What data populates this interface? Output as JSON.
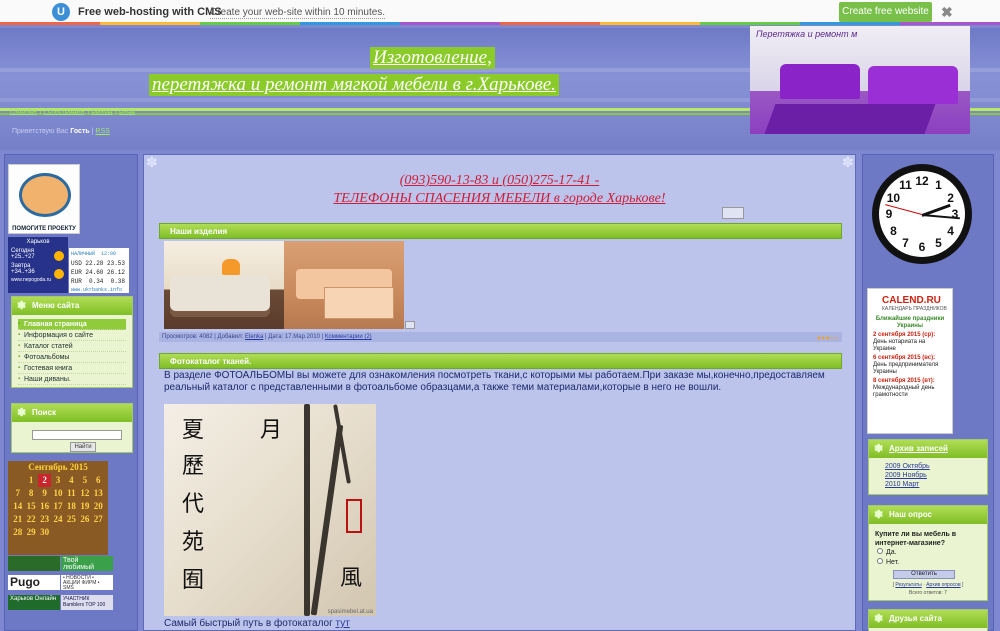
{
  "promo": {
    "logo_letter": "U",
    "title": "Free web-hosting with CMS",
    "subtitle": "Create your web-site within 10 minutes.",
    "cta": "Create free website",
    "close": "✖"
  },
  "header": {
    "title_line1": "Изготовление,",
    "title_line2": "перетяжка и ремонт мягкой мебели в г.Харькове.",
    "photo_caption": "Перетяжка и ремонт м",
    "nav": [
      "Главная",
      "Регистрация",
      "Выход",
      "Вход"
    ],
    "greeting_prefix": "Приветствую Вас",
    "greeting_user": "Гость",
    "rss": "RSS"
  },
  "left": {
    "help_caption": "ПОМОГИТЕ ПРОЕКТУ",
    "weather": {
      "city": "Харьков",
      "today_label": "Сегодня",
      "today_temp": "+25..+27",
      "tomorrow_label": "Завтра",
      "tomorrow_temp": "+34..+36",
      "source": "www.nepogoda.ru"
    },
    "rates": {
      "header": "НАЛИЧНЫЙ  12:00",
      "rows": [
        "USD 22.28 23.53",
        "EUR 24.60 26.12",
        "RUR  0.34  0.38"
      ],
      "source": "www.ukrbanks.info"
    },
    "menu_title": "Меню сайта",
    "menu_items": [
      "Главная страница",
      "Информация о сайте",
      "Каталог статей",
      "Фотоальбомы",
      "Гостевая книга",
      "Наши диваны."
    ],
    "search_title": "Поиск",
    "search_button": "Найти",
    "calendar": {
      "title": "Сентябрь 2015",
      "days": [
        "",
        "1",
        "2",
        "3",
        "4",
        "5",
        "6",
        "7",
        "8",
        "9",
        "10",
        "11",
        "12",
        "13",
        "14",
        "15",
        "16",
        "17",
        "18",
        "19",
        "20",
        "21",
        "22",
        "23",
        "24",
        "25",
        "26",
        "27",
        "28",
        "29",
        "30"
      ],
      "today": "2"
    },
    "counters": {
      "c1": "Твой любимый Харьков",
      "c2": "Pugo",
      "c2_news": "• НОВОСТИ • АКЦИИ ФИРМ • SMS",
      "c3": "Харьков Онлайн",
      "c4": "УЧАСТНИК Bamblers TOP 100"
    }
  },
  "main": {
    "phones_line": "(093)590-13-83 и (050)275-17-41 -",
    "phones_sub": "ТЕЛЕФОНЫ СПАСЕНИЯ МЕБЕЛИ в городе Харькове!",
    "section1_title": "Наши изделия",
    "info": {
      "views": "Просмотров: 4082",
      "added_by_label": "Добавил:",
      "added_by": "Elenka",
      "date": "Дата: 17.Мар.2010",
      "comments": "Комментарии (2)"
    },
    "section2_title": "Фотокаталог тканей.",
    "body_text": "В разделе ФОТОАЛЬБОМЫ вы можете для ознакомления посмотреть ткани,с которыми мы работаем.При заказе мы,конечно,предоставляем реальный каталог с представленными в фотоальбоме образцами,а также теми материалами,которые в него не вошли.",
    "fabric_glyphs": [
      "夏",
      "月",
      "歷",
      "代",
      "苑",
      "囿",
      "風"
    ],
    "fabric_watermark": "spasimebel.at.ua",
    "caption_text": "Самый быстрый путь в фотокаталог",
    "caption_link": "тут"
  },
  "right": {
    "clock_numbers": [
      "12",
      "1",
      "2",
      "3",
      "4",
      "5",
      "6",
      "7",
      "8",
      "9",
      "10",
      "11"
    ],
    "calendru": {
      "logo": "CALEND.RU",
      "sub": "КАЛЕНДАРЬ ПРАЗДНИКОВ",
      "heading": "Ближайшие праздники Украины",
      "items": [
        {
          "date": "2 сентября 2015 (ср):",
          "text": "День нотариата на Украине"
        },
        {
          "date": "6 сентября 2015 (вс):",
          "text": "День предпринимателя Украины"
        },
        {
          "date": "8 сентября 2015 (вт):",
          "text": "Международный день грамотности"
        }
      ]
    },
    "archive_title": "Архив записей",
    "archive_items": [
      "2009 Октябрь",
      "2009 Ноябрь",
      "2010 Март"
    ],
    "poll_title": "Наш опрос",
    "poll_question": "Купите ли вы мебель в интернет-магазине?",
    "poll_options": [
      "Да.",
      "Нет."
    ],
    "poll_button": "Ответить",
    "poll_results": "Результаты",
    "poll_archive": "Архив опросов",
    "poll_total": "Всего ответов: 7",
    "friends_title": "Друзья сайта"
  },
  "colors": {
    "accent_green": "#7fbe26",
    "phone_red": "#cc1d38",
    "bg_blue": "#7d88d0"
  }
}
